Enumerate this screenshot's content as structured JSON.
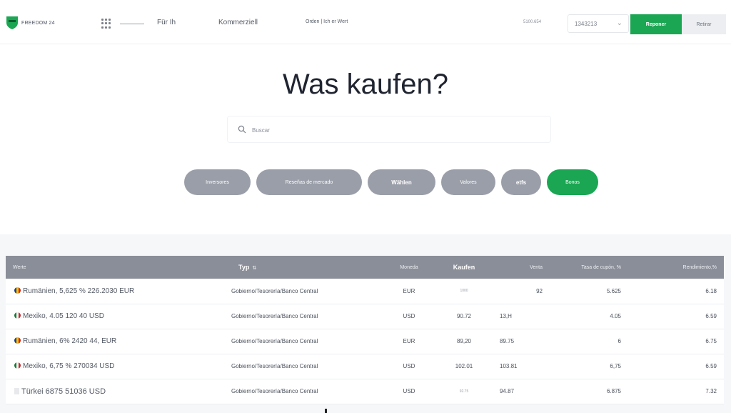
{
  "header": {
    "logo_text": "FREEDOM 24",
    "nav": [
      "Für Ih",
      "Kommerziell",
      "Orden | Ich er Wert"
    ],
    "code": "5100.654",
    "account": "1343213",
    "reponer_label": "Reponer",
    "retirar_label": "Retirar",
    "accent_color": "#1aa652"
  },
  "hero": {
    "title": "Was kaufen?",
    "search_placeholder": "Buscar"
  },
  "filters": [
    {
      "label": "Inversores",
      "active": false
    },
    {
      "label": "Reseñas de mercado",
      "active": false
    },
    {
      "label": "Wählen",
      "active": false
    },
    {
      "label": "Valores",
      "active": false
    },
    {
      "label": "etfs",
      "active": false
    },
    {
      "label": "Bonos",
      "active": true
    }
  ],
  "table": {
    "columns": {
      "name": "Werte",
      "type": "Typ",
      "currency": "Moneda",
      "buy": "Kaufen",
      "sell": "Venta",
      "coupon": "Tasa de cupón, %",
      "yield": "Rendimiento,%"
    },
    "rows": [
      {
        "flag": "ro",
        "name": "Rumänien, 5,625 % 226.2030 EUR",
        "type": "Gobierno/Tesorería/Banco Central",
        "currency": "EUR",
        "buy": "1000",
        "buy_tiny": true,
        "sell": "92",
        "coupon": "5.625",
        "yield": "6.18"
      },
      {
        "flag": "mx",
        "name": "Mexiko, 4.05 120 40 USD",
        "type": "Gobierno/Tesorería/Banco Central",
        "currency": "USD",
        "buy": "90.72",
        "buy_tiny": false,
        "sell": "13,H",
        "coupon": "4.05",
        "yield": "6.59"
      },
      {
        "flag": "ro",
        "name": "Rumänien, 6% 2420 44, EUR",
        "type": "Gobierno/Tesorería/Banco Central",
        "currency": "EUR",
        "buy": "89,20",
        "buy_tiny": false,
        "sell": "89.75",
        "coupon": "6",
        "yield": "6.75"
      },
      {
        "flag": "mx",
        "name": "Mexiko, 6,75 % 270034 USD",
        "type": "Gobierno/Tesorería/Banco Central",
        "currency": "USD",
        "buy": "102.01",
        "buy_tiny": false,
        "sell": "103.81",
        "coupon": "6,75",
        "yield": "6.59"
      },
      {
        "flag": "tr",
        "name": "Türkei 6875 51036 USD",
        "type": "Gobierno/Tesorería/Banco Central",
        "currency": "USD",
        "buy": "92.75",
        "buy_tiny": true,
        "sell": "94.87",
        "coupon": "6.875",
        "yield": "7.32"
      }
    ]
  }
}
